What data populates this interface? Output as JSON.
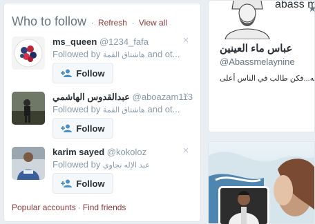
{
  "wtf": {
    "title": "Who to follow",
    "sep": "·",
    "refresh": "Refresh",
    "view_all": "View all",
    "suggestions": [
      {
        "name": "ms_queen",
        "handle": "@1234_fafa",
        "followed_prefix": "Followed by",
        "followed_names": "هاشتاق القمة",
        "followed_suffix": "and ot...",
        "follow_label": "Follow"
      },
      {
        "name": "عبدالقدوس الهاشمي",
        "handle": "@aboazam113",
        "followed_prefix": "Followed by",
        "followed_names": "هاشتاق القمة",
        "followed_suffix": "and ot...",
        "follow_label": "Follow"
      },
      {
        "name": "karim sayed",
        "handle": "@kokoloz",
        "followed_prefix": "Followed by",
        "followed_names": "عبد الإله نجاوي",
        "followed_suffix": "",
        "follow_label": "Follow"
      }
    ],
    "footer": {
      "popular": "Popular accounts",
      "sep": "·",
      "find_friends": "Find friends"
    }
  },
  "profile_card": {
    "header_text": "abass me",
    "name": "عباس ماء العينين",
    "handle": "@Abassmelaynine",
    "bio": "سه...فكن طالب في الناس أعلى"
  },
  "icons": {
    "dismiss": "close-icon",
    "follow": "add-person-icon",
    "star": "star-icon"
  },
  "colors": {
    "link": "#8b3a3a",
    "muted": "#8899a6",
    "button_bg": "#f5f8fa",
    "follow_icon": "#4a90c8"
  }
}
